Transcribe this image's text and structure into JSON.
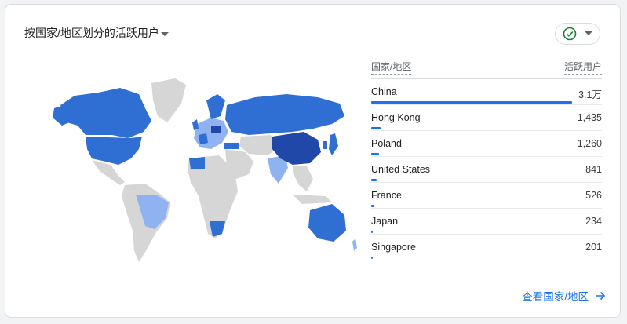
{
  "card": {
    "title": "按国家/地区划分的活跃用户",
    "footer_link": "查看国家/地区"
  },
  "table": {
    "col_country": "国家/地区",
    "col_users": "活跃用户",
    "rows": [
      {
        "country": "China",
        "value": "3.1万",
        "share": 1.0
      },
      {
        "country": "Hong Kong",
        "value": "1,435",
        "share": 0.046
      },
      {
        "country": "Poland",
        "value": "1,260",
        "share": 0.041
      },
      {
        "country": "United States",
        "value": "841",
        "share": 0.027
      },
      {
        "country": "France",
        "value": "526",
        "share": 0.017
      },
      {
        "country": "Japan",
        "value": "234",
        "share": 0.008
      },
      {
        "country": "Singapore",
        "value": "201",
        "share": 0.006
      }
    ]
  },
  "colors": {
    "accent": "#1a73e8",
    "map_dark": "#1f48a8",
    "map_mid": "#2f6fd3",
    "map_light": "#8fb3f0",
    "map_none": "#d6d6d6",
    "check": "#188038"
  },
  "icons": {
    "status": "check-circle-icon",
    "dropdown": "chevron-down-icon",
    "footer": "arrow-right-icon"
  }
}
